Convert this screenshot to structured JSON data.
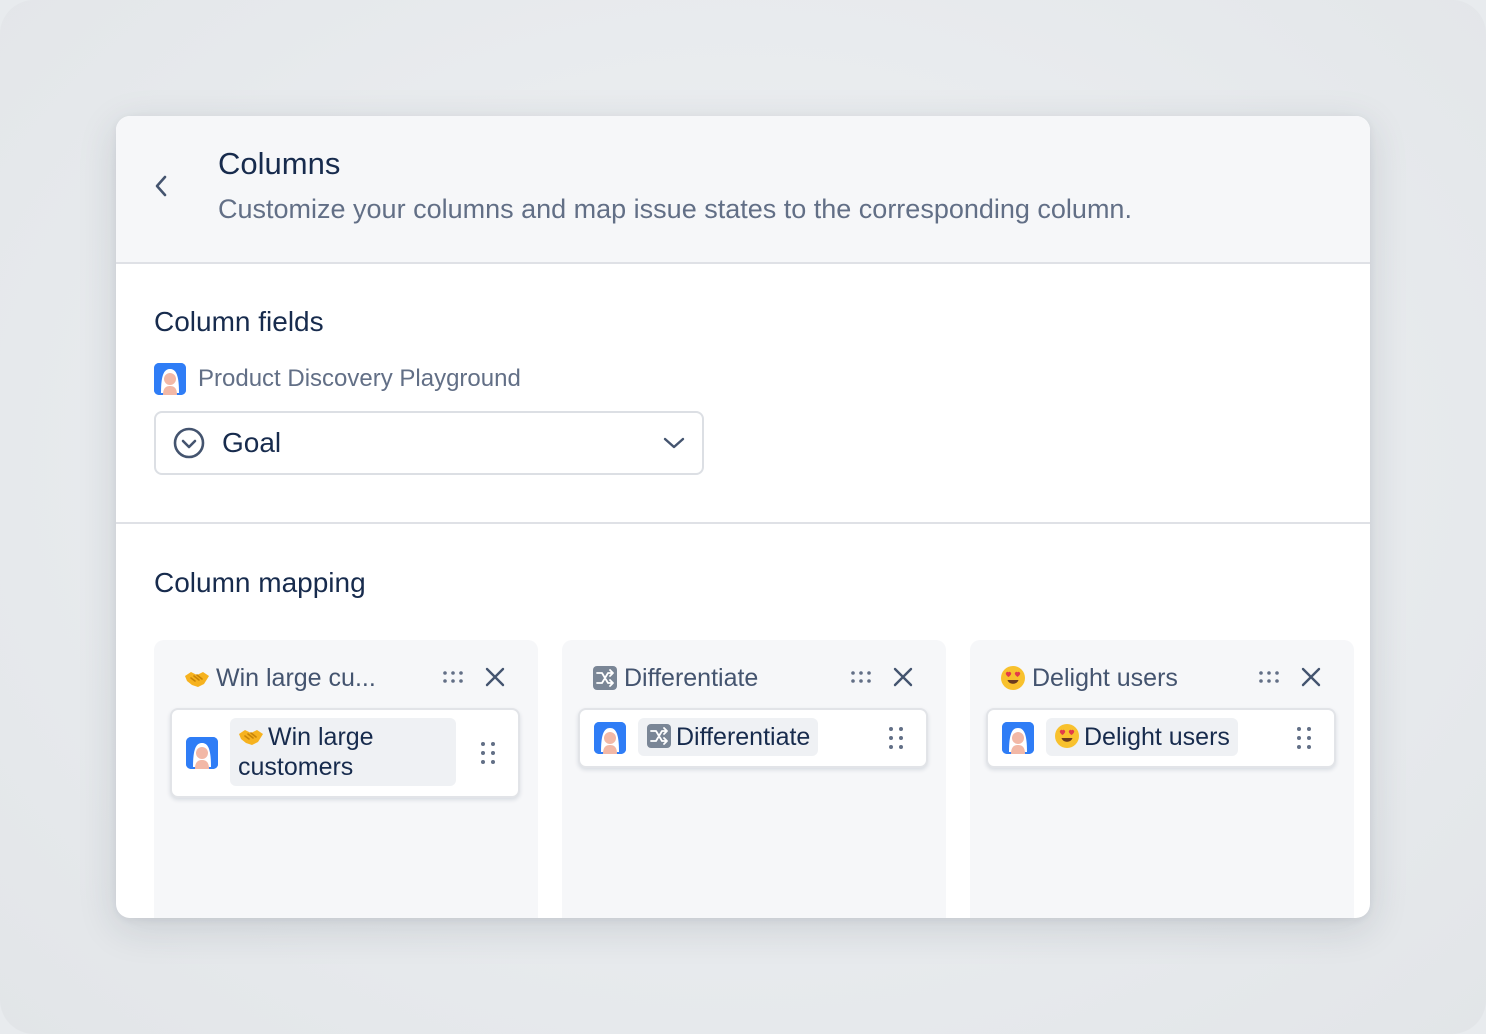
{
  "header": {
    "title": "Columns",
    "subtitle": "Customize your columns and map issue states to the corresponding column."
  },
  "column_fields": {
    "heading": "Column fields",
    "project_name": "Product Discovery Playground",
    "field_select": {
      "value": "Goal"
    }
  },
  "column_mapping": {
    "heading": "Column mapping",
    "columns": [
      {
        "name": "Win large cu...",
        "emoji": "handshake",
        "card_label": "Win large customers"
      },
      {
        "name": "Differentiate",
        "emoji": "shuffle",
        "card_label": "Differentiate"
      },
      {
        "name": "Delight users",
        "emoji": "heart-eyes",
        "card_label": "Delight users"
      }
    ]
  },
  "colors": {
    "primary_text": "#172b4d",
    "subtle_text": "#626f86",
    "avatar_blue": "#2f7df6"
  }
}
